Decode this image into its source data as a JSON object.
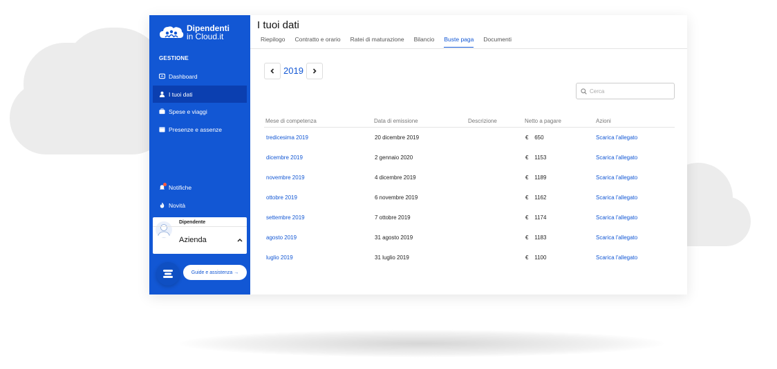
{
  "brand": {
    "line1": "Dipendenti",
    "line2": "in Cloud.it"
  },
  "sidebar": {
    "section_title": "GESTIONE",
    "items": [
      {
        "label": "Dashboard",
        "icon": "dashboard-icon"
      },
      {
        "label": "I tuoi dati",
        "icon": "user-icon",
        "active": true
      },
      {
        "label": "Spese e viaggi",
        "icon": "briefcase-icon"
      },
      {
        "label": "Presenze e assenze",
        "icon": "calendar-icon"
      }
    ],
    "bottom_items": [
      {
        "label": "Notifiche",
        "icon": "bell-icon"
      },
      {
        "label": "Novità",
        "icon": "flame-icon"
      }
    ],
    "user_card": {
      "role": "Dipendente",
      "company": "Azienda"
    },
    "help_button": "Guide e assistenza →"
  },
  "main": {
    "title": "I tuoi dati",
    "tabs": [
      {
        "label": "Riepilogo"
      },
      {
        "label": "Contratto e orario"
      },
      {
        "label": "Ratei di maturazione"
      },
      {
        "label": "Bilancio"
      },
      {
        "label": "Buste paga",
        "active": true
      },
      {
        "label": "Documenti"
      }
    ],
    "year": "2019",
    "search": {
      "placeholder": "Cerca",
      "value": ""
    },
    "table": {
      "headers": [
        "Mese di competenza",
        "Data di emissione",
        "Descrizione",
        "Netto a pagare",
        "Azioni"
      ],
      "currency": "€",
      "rows": [
        {
          "month": "tredicesima 2019",
          "date": "20 dicembre 2019",
          "description": "",
          "amount": "650",
          "action": "Scarica l'allegato"
        },
        {
          "month": "dicembre 2019",
          "date": "2 gennaio 2020",
          "description": "",
          "amount": "1153",
          "action": "Scarica l'allegato"
        },
        {
          "month": "novembre 2019",
          "date": "4 dicembre 2019",
          "description": "",
          "amount": "1189",
          "action": "Scarica l'allegato"
        },
        {
          "month": "ottobre 2019",
          "date": "6 novembre 2019",
          "description": "",
          "amount": "1162",
          "action": "Scarica l'allegato"
        },
        {
          "month": "settembre 2019",
          "date": "7 ottobre 2019",
          "description": "",
          "amount": "1174",
          "action": "Scarica l'allegato"
        },
        {
          "month": "agosto 2019",
          "date": "31 agosto 2019",
          "description": "",
          "amount": "1183",
          "action": "Scarica l'allegato"
        },
        {
          "month": "luglio 2019",
          "date": "31 luglio 2019",
          "description": "",
          "amount": "1100",
          "action": "Scarica l'allegato"
        }
      ]
    }
  },
  "colors": {
    "primary": "#1257d4",
    "sidebar_active": "#0b3fb0",
    "background_cloud": "#ececec"
  }
}
